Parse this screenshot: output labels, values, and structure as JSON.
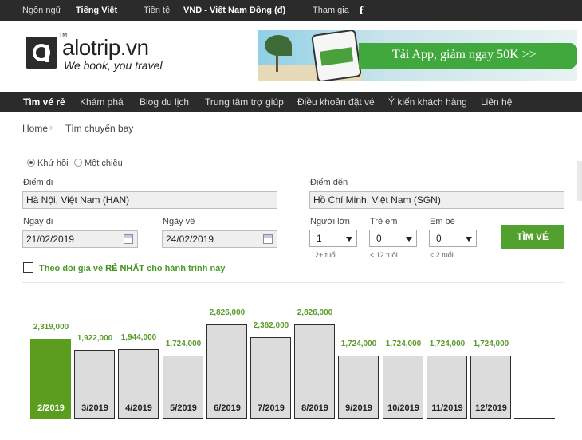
{
  "topbar": {
    "language_label": "Ngôn ngữ",
    "language_value": "Tiếng Việt",
    "currency_label": "Tiền tệ",
    "currency_value": "VND - Việt Nam Đồng (đ)",
    "join_label": "Tham gia",
    "facebook_icon": "f"
  },
  "logo": {
    "name": "alotrip.vn",
    "tagline": "We book, you travel",
    "tm": "TM"
  },
  "banner": {
    "text": "Tải App, giảm ngay 50K >>"
  },
  "nav": {
    "items": [
      "Tìm vé rẻ",
      "Khám phá",
      "Blog du lịch",
      "Trung tâm trợ giúp",
      "Điều khoản đặt vé",
      "Ý kiến khách hàng",
      "Liên hệ"
    ]
  },
  "breadcrumb": {
    "home": "Home",
    "current": "Tìm chuyến bay",
    "separator": "›"
  },
  "form": {
    "trip_round": "Khứ hồi",
    "trip_oneway": "Một chiều",
    "trip_selected": "Khứ hồi",
    "from_label": "Điểm đi",
    "from_value": "Hà Nội, Việt Nam (HAN)",
    "to_label": "Điểm đến",
    "to_value": "Hồ Chí Minh, Việt Nam (SGN)",
    "depart_label": "Ngày đi",
    "depart_value": "21/02/2019",
    "return_label": "Ngày về",
    "return_value": "24/02/2019",
    "adults_label": "Người lớn",
    "adults_value": "1",
    "adults_hint": "12+ tuổi",
    "children_label": "Trẻ em",
    "children_value": "0",
    "children_hint": "< 12 tuổi",
    "infants_label": "Em bé",
    "infants_value": "0",
    "infants_hint": "< 2 tuổi",
    "search_button": "TÌM VÉ",
    "track_text_prefix": "Theo dõi giá vé ",
    "track_text_bold": "RẺ NHẤT",
    "track_text_suffix": " cho hành trình này"
  },
  "chart_data": {
    "type": "bar",
    "categories": [
      "2/2019",
      "3/2019",
      "4/2019",
      "5/2019",
      "6/2019",
      "7/2019",
      "8/2019",
      "9/2019",
      "10/2019",
      "11/2019",
      "12/2019"
    ],
    "values": [
      2319000,
      1922000,
      1944000,
      1724000,
      2826000,
      2362000,
      2826000,
      1724000,
      1724000,
      1724000,
      1724000
    ],
    "value_labels": [
      "2,319,000",
      "1,922,000",
      "1,944,000",
      "1,724,000",
      "2,826,000",
      "2,362,000",
      "2,826,000",
      "1,724,000",
      "1,724,000",
      "1,724,000",
      "1,724,000"
    ],
    "selected_index": 0,
    "selected_color": "#5a9d1f",
    "bar_color": "#dcdcdc",
    "label_color": "#5a9a2a"
  }
}
